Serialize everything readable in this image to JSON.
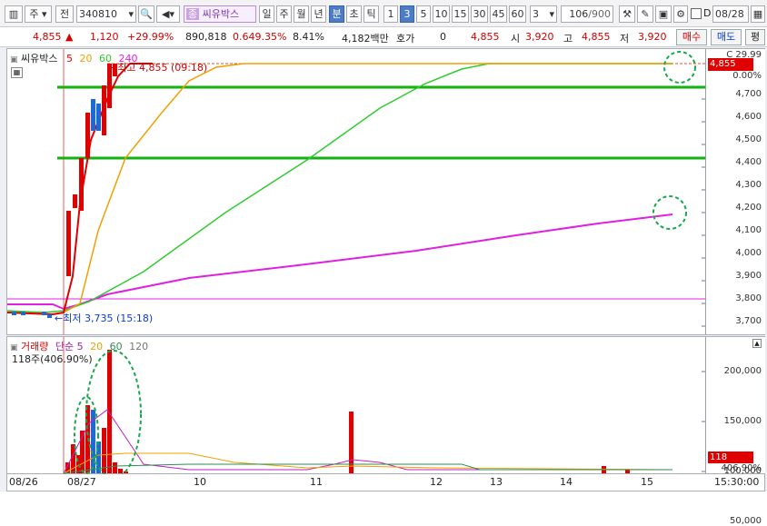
{
  "toolbar": {
    "mode": "주",
    "type": "전",
    "code": "340810",
    "name_badge": "종",
    "name": "씨유박스",
    "periods": [
      "일",
      "주",
      "월",
      "년"
    ],
    "active_unit": "분",
    "units": [
      "초",
      "틱"
    ],
    "intervals": [
      "1",
      "3",
      "5",
      "10",
      "15",
      "30",
      "45",
      "60"
    ],
    "active_interval": "3",
    "interval_select": "3",
    "count": "106",
    "count_max": "/900",
    "d_label": "D",
    "date": "08/28"
  },
  "quote": {
    "price": "4,855",
    "change": "1,120",
    "change_pct": "+29.99%",
    "volume": "890,818",
    "vol_ratio": "0.649.35%",
    "turnover": "8.41%",
    "amount": "4,182백만",
    "hoga_label": "호가",
    "hoga_value": "0",
    "current": "4,855",
    "open_label": "시",
    "open": "3,920",
    "high_label": "고",
    "high": "4,855",
    "low_label": "저",
    "low": "3,920",
    "buy_btn": "매수",
    "sell_btn": "매도",
    "eval_btn": "평"
  },
  "price_chart": {
    "legend_name": "씨유박스",
    "legend_ma": [
      "5",
      "20",
      "60",
      "240"
    ],
    "max_label": "최고 4,855 (09:18)",
    "min_label": "최저 3,735 (15:18)",
    "axis_top_label": "C 29.99",
    "axis_zero_label": "0.00%",
    "current_tag": "4,855",
    "y_ticks": [
      "4,700",
      "4,600",
      "4,500",
      "4,400",
      "4,300",
      "4,200",
      "4,100",
      "4,000",
      "3,900",
      "3,800",
      "3,700"
    ]
  },
  "volume_chart": {
    "legend_title": "거래량",
    "legend_simple": "단순",
    "legend_ma": [
      "5",
      "20",
      "60",
      "120"
    ],
    "sub_label": "118주(406.90%)",
    "y_ticks": [
      "200,000",
      "150,000",
      "100,000",
      "50,000"
    ],
    "current_tag": "118",
    "current_pct": "406.90%"
  },
  "x_axis": {
    "labels": [
      "08/26",
      "08/27",
      "10",
      "11",
      "12",
      "13",
      "14",
      "15"
    ],
    "end_time": "15:30:00"
  },
  "colors": {
    "ma5": "#e00000",
    "ma20": "#f0a000",
    "ma60": "#2ecc2e",
    "ma240": "#e020e0",
    "hline": "#13b213",
    "annotation": "#1aa84c"
  }
}
